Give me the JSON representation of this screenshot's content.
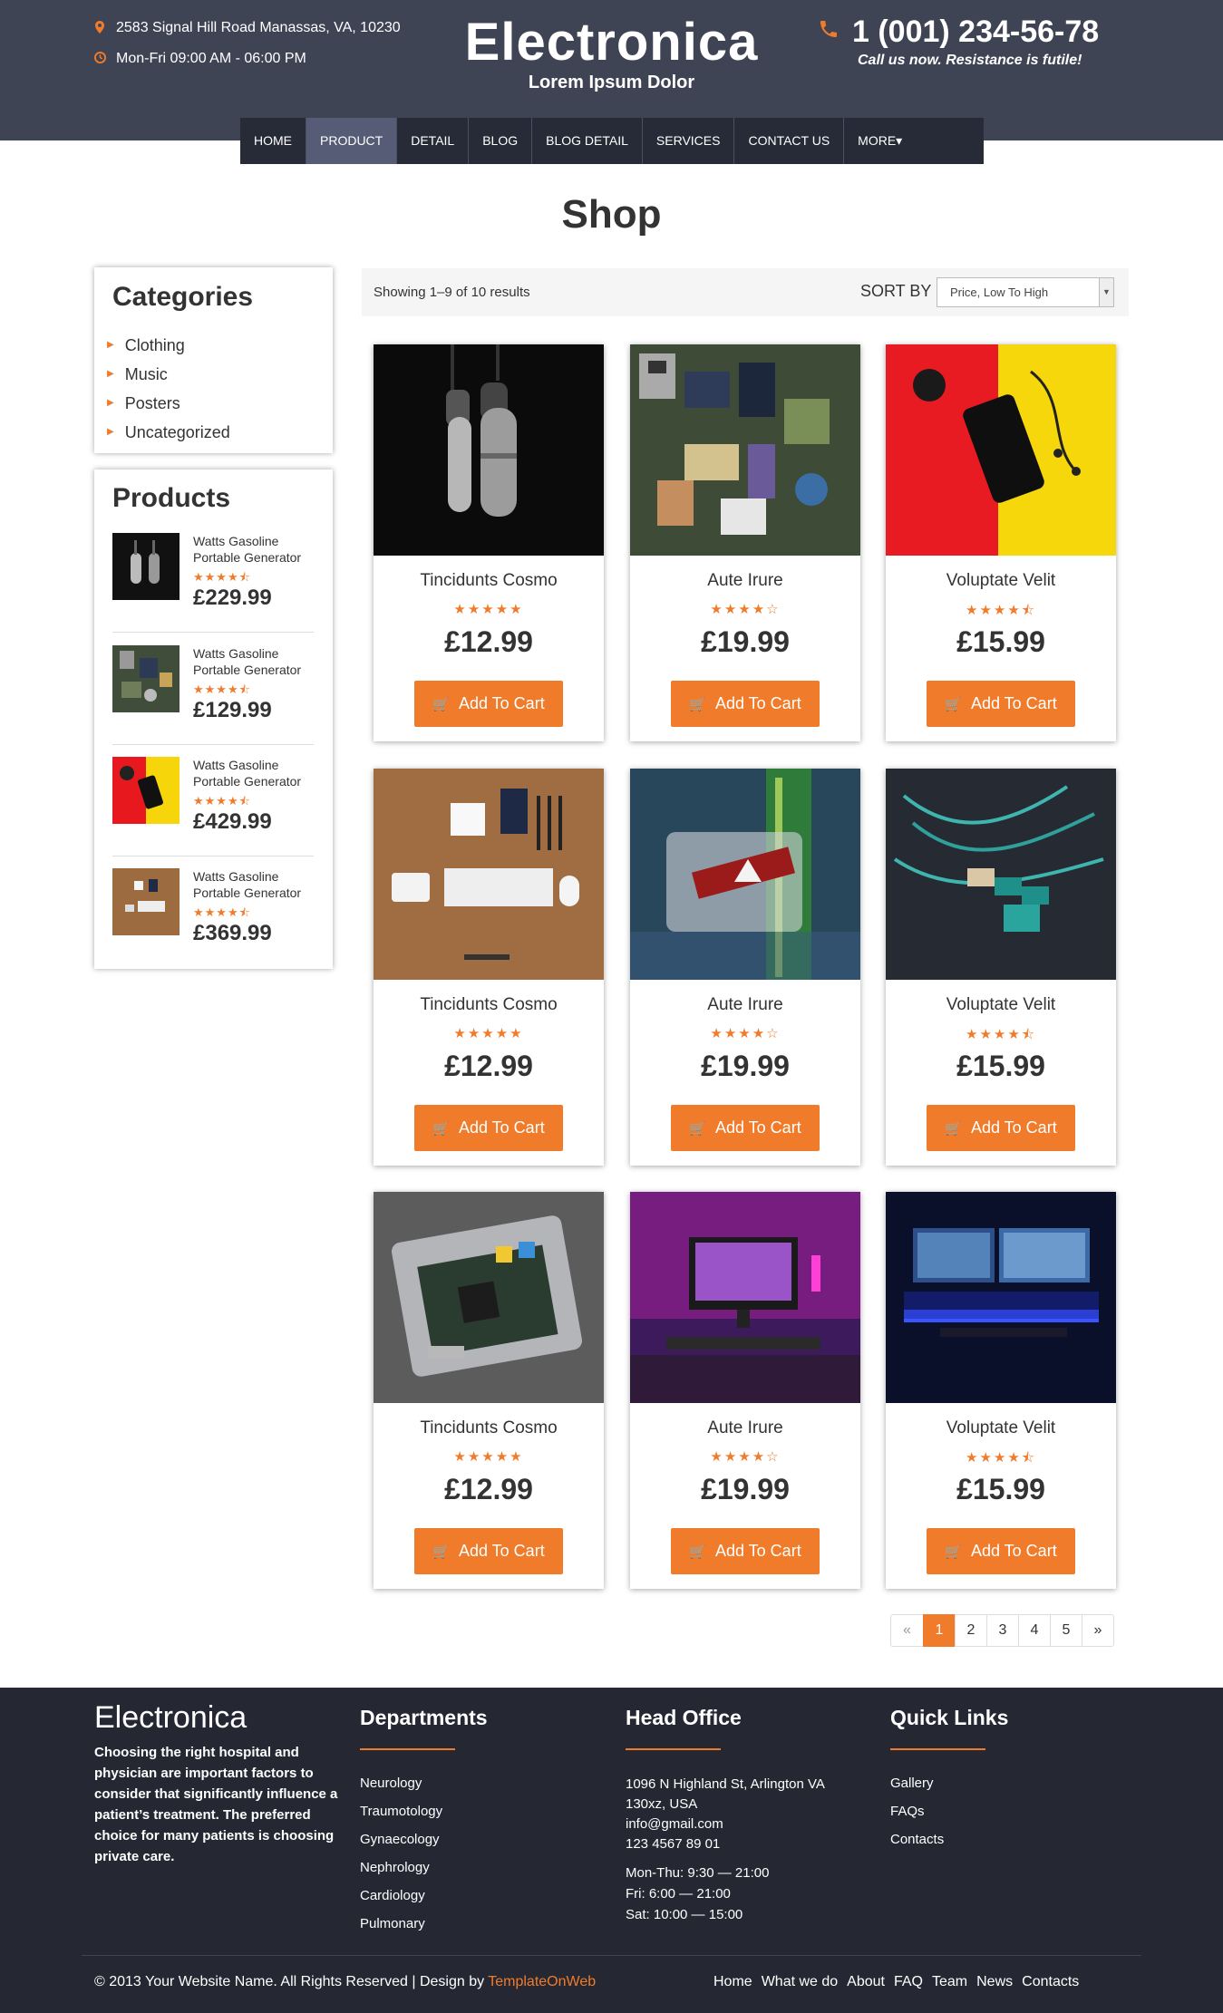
{
  "header": {
    "address": "2583 Signal Hill Road Manassas, VA, 10230",
    "hours": "Mon-Fri 09:00 AM - 06:00 PM",
    "brand": "Electronica",
    "tagline": "Lorem Ipsum Dolor",
    "phone": "1 (001) 234-56-78",
    "phone_note": "Call us now. Resistance is futile!"
  },
  "nav": [
    "HOME",
    "PRODUCT",
    "DETAIL",
    "BLOG",
    "BLOG DETAIL",
    "SERVICES",
    "CONTACT US",
    "MORE▾"
  ],
  "nav_active": "PRODUCT",
  "page_title": "Shop",
  "categories": {
    "title": "Categories",
    "items": [
      "Clothing",
      "Music",
      "Posters",
      "Uncategorized"
    ]
  },
  "sidebar_products": {
    "title": "Products",
    "items": [
      {
        "name": "Watts Gasoline Portable Generator",
        "rating": 4.5,
        "stars": "★★★★⯪",
        "price": "£229.99"
      },
      {
        "name": "Watts Gasoline Portable Generator",
        "rating": 4.5,
        "stars": "★★★★⯪",
        "price": "£129.99"
      },
      {
        "name": "Watts Gasoline Portable Generator",
        "rating": 4.5,
        "stars": "★★★★⯪",
        "price": "£429.99"
      },
      {
        "name": "Watts Gasoline Portable Generator",
        "rating": 4.5,
        "stars": "★★★★⯪",
        "price": "£369.99"
      }
    ]
  },
  "toolbar": {
    "results": "Showing 1–9 of 10 results",
    "sort_label": "SORT BY",
    "sort_value": "Price, Low To High"
  },
  "products": [
    {
      "name": "Tincidunts Cosmo",
      "rating": 5,
      "stars": "★★★★★",
      "price": "£12.99",
      "button": "Add To Cart"
    },
    {
      "name": "Aute Irure",
      "rating": 4,
      "stars": "★★★★☆",
      "price": "£19.99",
      "button": "Add To Cart"
    },
    {
      "name": "Voluptate Velit",
      "rating": 4.5,
      "stars": "★★★★⯪",
      "price": "£15.99",
      "button": "Add To Cart"
    },
    {
      "name": "Tincidunts Cosmo",
      "rating": 5,
      "stars": "★★★★★",
      "price": "£12.99",
      "button": "Add To Cart"
    },
    {
      "name": "Aute Irure",
      "rating": 4,
      "stars": "★★★★☆",
      "price": "£19.99",
      "button": "Add To Cart"
    },
    {
      "name": "Voluptate Velit",
      "rating": 4.5,
      "stars": "★★★★⯪",
      "price": "£15.99",
      "button": "Add To Cart"
    },
    {
      "name": "Tincidunts Cosmo",
      "rating": 5,
      "stars": "★★★★★",
      "price": "£12.99",
      "button": "Add To Cart"
    },
    {
      "name": "Aute Irure",
      "rating": 4,
      "stars": "★★★★☆",
      "price": "£19.99",
      "button": "Add To Cart"
    },
    {
      "name": "Voluptate Velit",
      "rating": 4.5,
      "stars": "★★★★⯪",
      "price": "£15.99",
      "button": "Add To Cart"
    }
  ],
  "pagination": [
    "«",
    "1",
    "2",
    "3",
    "4",
    "5",
    "»"
  ],
  "pagination_active": "1",
  "footer": {
    "brand": "Electronica",
    "about": "Choosing the right hospital and physician are important factors to consider that significantly influence a patient’s treatment. The preferred choice for many patients is choosing private care.",
    "departments_title": "Departments",
    "departments": [
      "Neurology",
      "Traumotology",
      "Gynaecology",
      "Nephrology",
      "Cardiology",
      "Pulmonary"
    ],
    "office_title": "Head Office",
    "office_address_1": "1096 N Highland St, Arlington VA",
    "office_address_2": "130xz, USA",
    "office_email": "info@gmail.com",
    "office_phone": "123 4567 89 01",
    "office_hours": [
      "Mon-Thu: 9:30 — 21:00",
      "Fri: 6:00 — 21:00",
      "Sat: 10:00 — 15:00"
    ],
    "links_title": "Quick Links",
    "links": [
      "Gallery",
      "FAQs",
      "Contacts"
    ],
    "copyright": "© 2013 Your Website Name. All Rights Reserved | Design by",
    "designer": "TemplateOnWeb",
    "bottom_nav": [
      "Home",
      "What we do",
      "About",
      "FAQ",
      "Team",
      "News",
      "Contacts"
    ]
  },
  "colors": {
    "accent": "#f07c2b",
    "header_bg": "#3f4455",
    "nav_bg": "#272b37",
    "nav_active": "#565c75",
    "footer_bg": "#252833"
  },
  "icons": {
    "address": "map-marker-icon",
    "hours": "clock-icon",
    "phone": "phone-icon",
    "cart": "cart-icon",
    "category": "caret-right-icon"
  }
}
